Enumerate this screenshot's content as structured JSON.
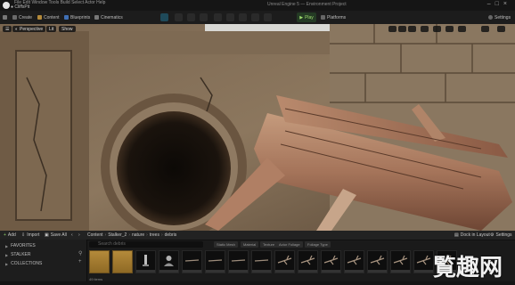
{
  "titlebar": {
    "menu": "File  Edit  Window  Tools  Build  Select  Actor  Help",
    "tab_name": "● CliffsPit",
    "project": "Unreal Engine 5 — Environment Project"
  },
  "toolbar": {
    "create": "Create",
    "content": "Content",
    "blueprints": "Blueprints",
    "cinematics": "Cinematics",
    "play": "Play",
    "platforms": "Platforms",
    "settings": "Settings"
  },
  "viewport": {
    "perspective": "Perspective",
    "lit": "Lit",
    "show": "Show"
  },
  "content_browser": {
    "add": "Add",
    "import": "Import",
    "save_all": "Save All",
    "path": [
      "Content",
      "Stalker_2",
      "nature",
      "trees",
      "debris"
    ],
    "dock": "Dock in Layout",
    "settings": "Settings",
    "search_placeholder": "Search debris",
    "filters": [
      "Static Mesh",
      "Material",
      "Texture",
      "Actor Foliage",
      "Foliage Type"
    ],
    "sidebar": {
      "favorites": "FAVORITES",
      "stalker": "STALKER",
      "collections": "COLLECTIONS"
    },
    "item_count": "49 items",
    "assets": [
      {
        "kind": "folder"
      },
      {
        "kind": "folder"
      },
      {
        "kind": "mesh",
        "shape": "statue"
      },
      {
        "kind": "mesh",
        "shape": "bust"
      },
      {
        "kind": "mesh",
        "shape": "stick"
      },
      {
        "kind": "mesh",
        "shape": "stick"
      },
      {
        "kind": "mesh",
        "shape": "stick"
      },
      {
        "kind": "mesh",
        "shape": "stick"
      },
      {
        "kind": "mesh",
        "shape": "branch"
      },
      {
        "kind": "mesh",
        "shape": "branch"
      },
      {
        "kind": "mesh",
        "shape": "branch"
      },
      {
        "kind": "mesh",
        "shape": "branch"
      },
      {
        "kind": "mesh",
        "shape": "branch"
      },
      {
        "kind": "mesh",
        "shape": "branch"
      },
      {
        "kind": "mesh",
        "shape": "branch"
      },
      {
        "kind": "mesh",
        "shape": "branch"
      }
    ]
  },
  "watermark": "觅趣网",
  "colors": {
    "accent_green": "#9fdc6f",
    "panel_bg": "#1a1a1a",
    "folder": "#b48a3a"
  }
}
